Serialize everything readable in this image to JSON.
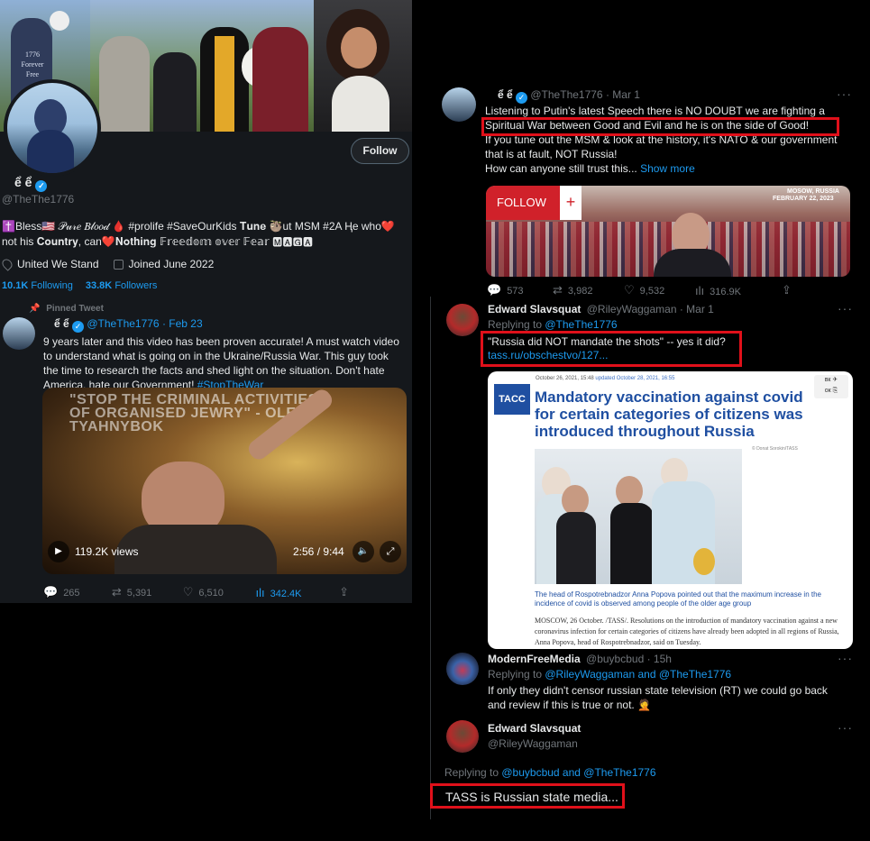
{
  "profile": {
    "name_glyphs": "ể ể",
    "handle": "@TheThe1776",
    "follow_label": "Follow",
    "bio": "✝️Bless🇺🇸 𝒫𝓊𝓇𝑒 𝐵𝓁𝑜𝑜𝒹 🩸 #prolife #SaveOurKids 𝐓𝐮𝐧𝐞 🦥ut MSM #2A Ⱨe who❤️ not his 𝐂𝐨𝐮𝐧𝐭𝐫𝐲, can❤️𝐍𝐨𝐭𝐡𝐢𝐧𝐠 𝔽𝕣𝕖𝕖𝕕𝕠𝕞 𝕠𝕧𝕖𝕣 𝔽𝕖𝕒𝕣 🅼🅰🅶🅰",
    "location": "United We Stand",
    "joined": "Joined June 2022",
    "following_count": "10.1K",
    "following_label": "Following",
    "followers_count": "33.8K",
    "followers_label": "Followers",
    "banner_shirt_text": "1776 Forever Free"
  },
  "pinned": {
    "label": "Pinned Tweet",
    "name_glyphs": "ể ể",
    "handle_date": "@TheThe1776 · Feb 23",
    "text": "9 years later and this video has been proven accurate!  A must watch video to understand what is going on in the Ukraine/Russia War. This guy took the time to research the facts and shed light on the situation. Don't hate America, hate our Government! ",
    "hashtag": "#StopTheWar",
    "video_caption": "\"STOP THE CRIMINAL ACTIVITIES OF ORGANISED JEWRY\" - OLEH TYAHNYBOK",
    "views": "119.2K views",
    "time": "2:56 / 9:44",
    "replies": "265",
    "retweets": "5,391",
    "likes": "6,510",
    "analytics": "342.4K"
  },
  "tweet1": {
    "name_glyphs": "ể ể",
    "handle_date": "@TheThe1776 · Mar 1",
    "line1": "Listening to Putin's latest Speech there is NO DOUBT we are fighting a",
    "line2": "Spiritual War between Good and Evil and he is on the side of Good!",
    "line3": "If you tune out the MSM & look at the history, it's NATO & our government that is at fault, NOT Russia!",
    "line4": "How can anyone still trust this... ",
    "show_more": "Show more",
    "media_follow": "FOLLOW",
    "media_plus": "+",
    "media_location": "MOSOW, RUSSIA",
    "media_date": "FEBRUARY 22, 2023",
    "replies": "573",
    "retweets": "3,982",
    "likes": "9,532",
    "analytics": "316.9K"
  },
  "reply1": {
    "name": "Edward Slavsquat",
    "handle_date": "@RileyWaggaman · Mar 1",
    "replying_prefix": "Replying to ",
    "replying_to": "@TheThe1776",
    "text": "\"Russia did NOT mandate the shots\" -- yes it did?",
    "link": "tass.ru/obschestvo/127...",
    "card": {
      "logo": "TACC",
      "dateline": "October 26, 2021, 15:48",
      "updated": "updated October 28, 2021, 16:55",
      "headline": "Mandatory vaccination against covid for certain categories of citizens was introduced throughout Russia",
      "photo_credit": "© Donat Sorokin/TASS",
      "lead": "The head of Rospotrebnadzor Anna Popova pointed out that the maximum increase in the incidence of covid is observed among people of the older age group",
      "body": "MOSCOW, 26 October. /TASS/. Resolutions on the introduction of mandatory vaccination against a new coronavirus infection for certain categories of citizens have already been adopted in all regions of Russia, Anna Popova, head of Rospotrebnadzor, said on Tuesday."
    }
  },
  "reply2": {
    "name": "ModernFreeMedia",
    "handle_date": "@buybcbud · 15h",
    "replying_prefix": "Replying to ",
    "replying_to": "@RileyWaggaman and @TheThe1776",
    "text": "If only they didn't censor russian state television (RT) we could go back and review if this is true or not. 🤦"
  },
  "reply3": {
    "name": "Edward Slavsquat",
    "handle": "@RileyWaggaman",
    "replying_prefix": "Replying to ",
    "replying_to": "@buybcbud and @TheThe1776",
    "text": "TASS is Russian state media..."
  },
  "colors": {
    "accent": "#1d9bf0",
    "highlight_box": "#e0101a",
    "background": "#000000",
    "panel": "#15181c"
  }
}
